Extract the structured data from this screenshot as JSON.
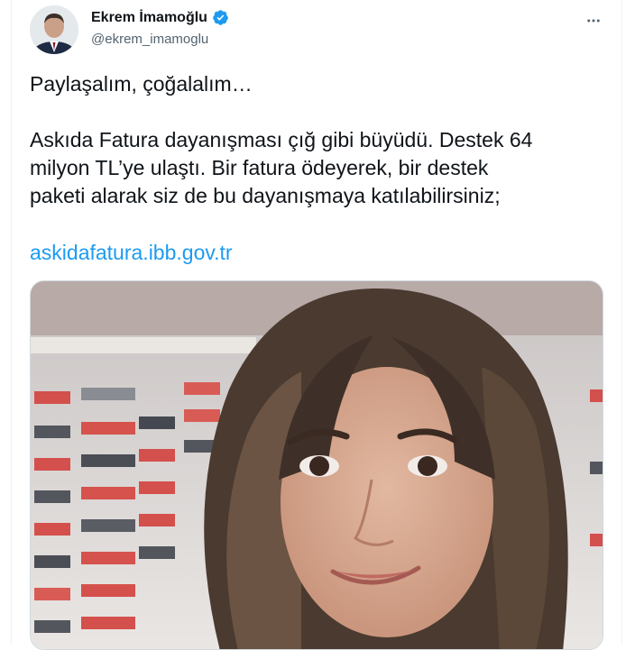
{
  "author": {
    "display_name": "Ekrem İmamoğlu",
    "handle": "@ekrem_imamoglu",
    "verified": true,
    "avatar_icon": "person-avatar-icon"
  },
  "tweet": {
    "line1": "Paylaşalım, çoğalalım…",
    "body": "Askıda Fatura dayanışması çığ gibi büyüdü. Destek 64\nmilyon TL’ye ulaştı. Bir fatura ödeyerek, bir destek\npaketi alarak siz de bu dayanışmaya katılabilirsiniz;",
    "link": "askidafatura.ibb.gov.tr"
  },
  "colors": {
    "accent": "#1d9bf0",
    "text": "#0f1419",
    "muted": "#536471",
    "border": "#cfd9de"
  },
  "icons": {
    "verified": "verified-badge-icon",
    "more": "more-horizontal-icon"
  },
  "media": {
    "type": "photo"
  }
}
